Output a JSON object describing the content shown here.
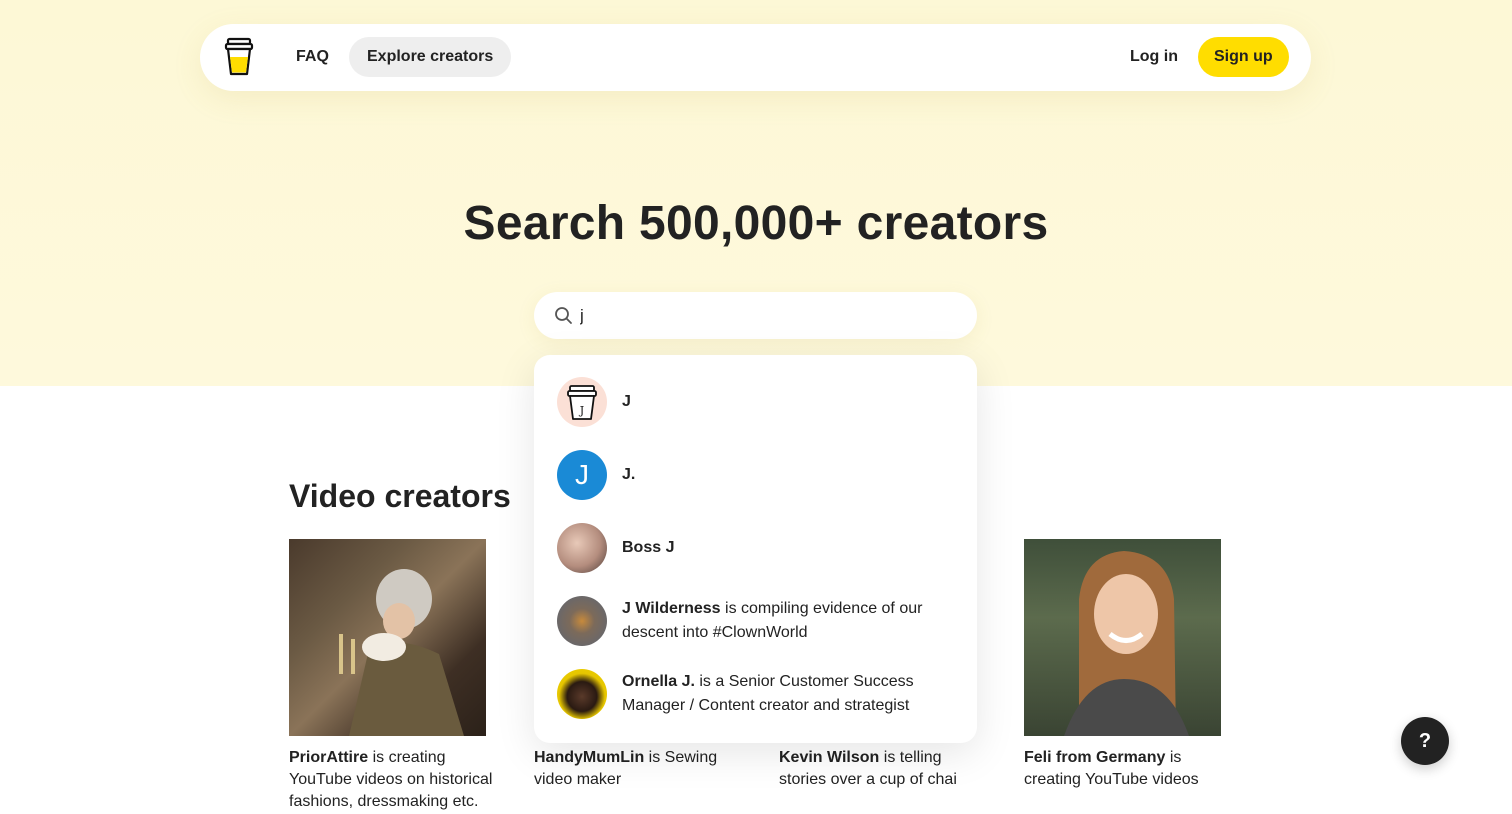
{
  "nav": {
    "faq": "FAQ",
    "explore": "Explore creators",
    "login": "Log in",
    "signup": "Sign up",
    "logo_icon": "coffee-cup-logo"
  },
  "hero": {
    "title": "Search 500,000+ creators",
    "search_value": "j",
    "search_icon": "search-icon"
  },
  "results": [
    {
      "name": "J",
      "desc": "",
      "avatar": "cup-avatar-j"
    },
    {
      "name": "J.",
      "desc": "",
      "avatar": "letter-avatar-j"
    },
    {
      "name": "Boss J",
      "desc": "",
      "avatar": "photo-avatar"
    },
    {
      "name": "J Wilderness",
      "desc": " is compiling evidence of our descent into #ClownWorld",
      "avatar": "photo-avatar"
    },
    {
      "name": "Ornella J.",
      "desc": " is a Senior Customer Success Manager / Content creator and strategist",
      "avatar": "photo-avatar"
    }
  ],
  "section": {
    "title": "Video creators"
  },
  "cards": [
    {
      "name": "PriorAttire",
      "desc": " is creating YouTube videos on historical fashions, dressmaking etc."
    },
    {
      "name": "HandyMumLin",
      "desc": " is Sewing video maker"
    },
    {
      "name": "Kevin Wilson",
      "desc": " is telling stories over a cup of chai"
    },
    {
      "name": "Feli from Germany",
      "desc": " is creating YouTube videos"
    }
  ],
  "help": {
    "label": "?"
  },
  "colors": {
    "accent": "#ffdd00",
    "hero_bg": "#fdf8d6",
    "text": "#222222",
    "avatar_blue": "#1a8ad6"
  }
}
